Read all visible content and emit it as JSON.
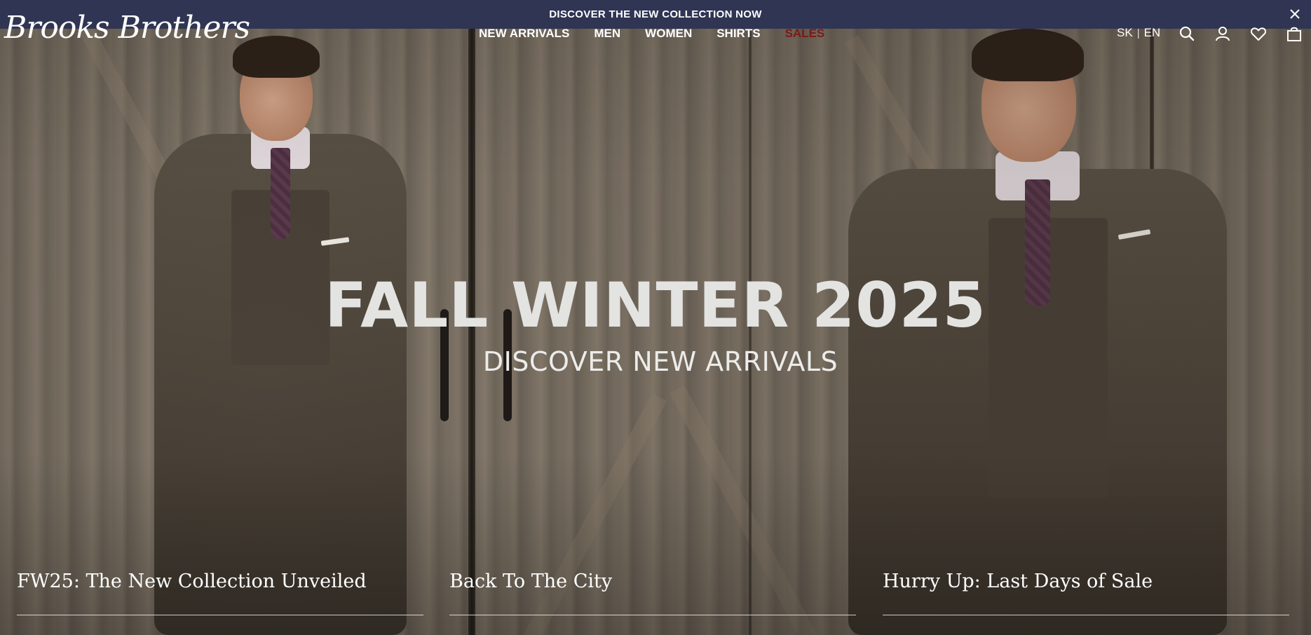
{
  "announcement": {
    "text": "DISCOVER THE NEW COLLECTION NOW",
    "close_icon": "close-icon"
  },
  "header": {
    "logo": "Brooks Brothers",
    "nav": [
      {
        "label": "NEW ARRIVALS"
      },
      {
        "label": "MEN"
      },
      {
        "label": "WOMEN"
      },
      {
        "label": "SHIRTS"
      },
      {
        "label": "SALES"
      }
    ],
    "sales_color": "#7a1a17",
    "language": {
      "sk": "SK",
      "separator": "|",
      "en": "EN"
    },
    "icons": [
      "search-icon",
      "account-icon",
      "wishlist-heart-icon",
      "shopping-bag-icon"
    ]
  },
  "hero": {
    "title": "FALL WINTER 2025",
    "subtitle": "DISCOVER NEW ARRIVALS"
  },
  "cards": [
    {
      "label": "FW25: The New Collection Unveiled"
    },
    {
      "label": "Back To The City"
    },
    {
      "label": "Hurry Up: Last Days of Sale"
    }
  ],
  "colors": {
    "announcement_bg": "#2f3553",
    "text": "#ffffff"
  }
}
